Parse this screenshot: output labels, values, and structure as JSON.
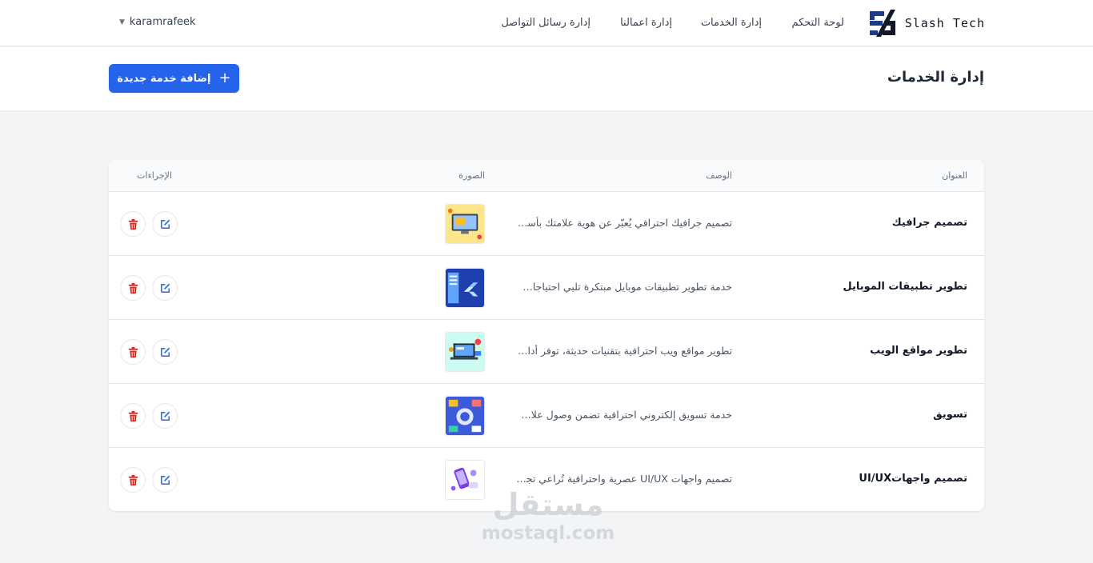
{
  "brand": {
    "name": "Slash Tech",
    "logo_icon": "slash-tech-logo"
  },
  "nav": {
    "links": [
      "لوحة التحكم",
      "إدارة الخدمات",
      "إدارة اعمالنا",
      "إدارة رسائل التواصل"
    ],
    "user": "karamrafeek"
  },
  "header": {
    "title": "إدارة الخدمات",
    "add_button": "إضافة خدمة جديدة"
  },
  "table": {
    "columns": [
      "العنوان",
      "الوصف",
      "الصورة",
      "الإجراءات"
    ],
    "rows": [
      {
        "title": "تصميم جرافيك",
        "description": "تصميم جرافيك احترافي يُعبّر عن هوية علامتك بأسلوب مميز",
        "image": "graphic-design-thumbnail"
      },
      {
        "title": "تطوير تطبيقات الموبايل",
        "description": "خدمة تطوير تطبيقات موبايل مبتكرة تلبي احتياجات عملائك",
        "image": "mobile-apps-thumbnail"
      },
      {
        "title": "تطوير مواقع الويب",
        "description": "تطوير مواقع ويب احترافية بتقنيات حديثة، توفر أداءً عالياً",
        "image": "web-development-thumbnail"
      },
      {
        "title": "تسويق",
        "description": "خدمة تسويق إلكتروني احترافية تضمن وصول علامتك التجارية",
        "image": "marketing-thumbnail"
      },
      {
        "title": "تصميم واجهاتUI/UX",
        "description": "تصميم واجهات UI/UX عصرية واحترافية تُراعي تجربة المستخدم",
        "image": "ui-ux-thumbnail"
      }
    ]
  },
  "watermark": {
    "arabic": "مستقل",
    "latin": "mostaql.com"
  },
  "colors": {
    "primary": "#2563eb",
    "danger": "#dc2626",
    "edit": "#2563eb"
  }
}
